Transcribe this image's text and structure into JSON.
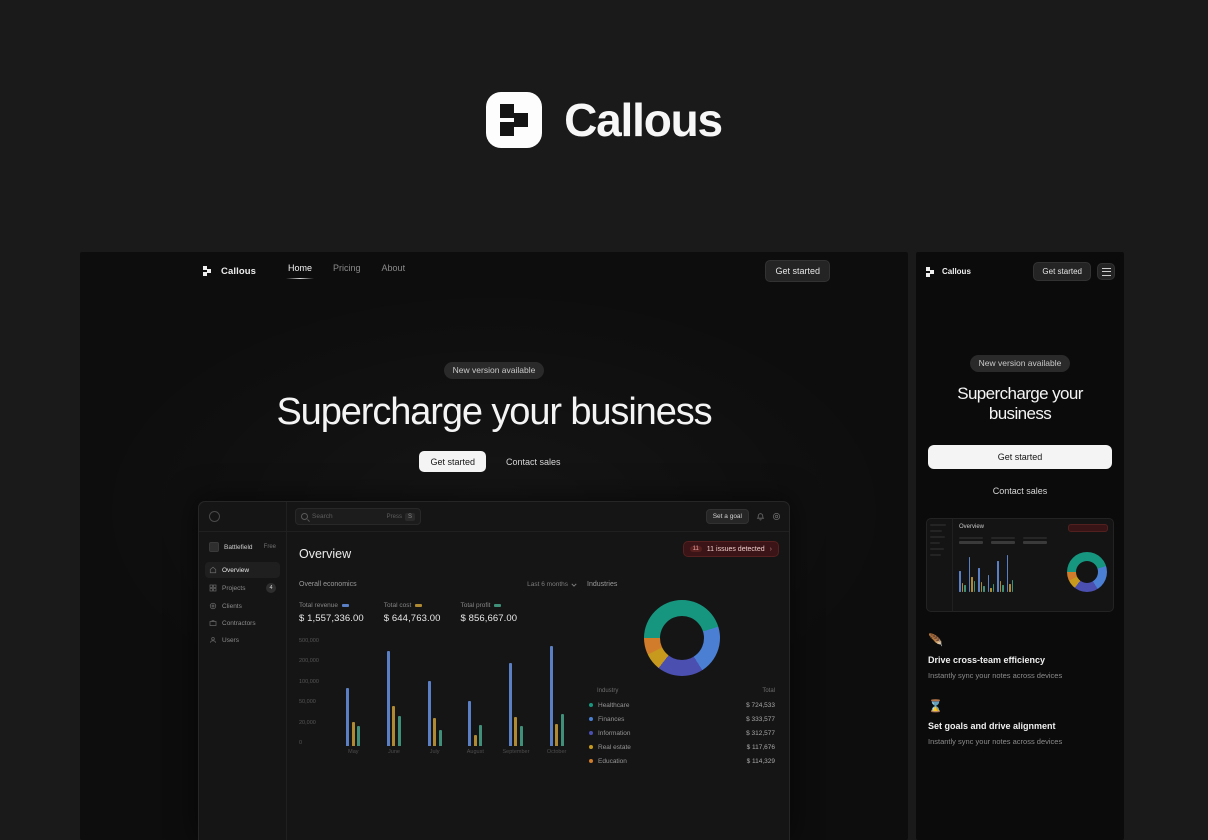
{
  "brand": {
    "name": "Callous",
    "mark_icon": "callous-logo-icon"
  },
  "desktop": {
    "nav": {
      "brand": "Callous",
      "links": [
        {
          "label": "Home",
          "active": true
        },
        {
          "label": "Pricing",
          "active": false
        },
        {
          "label": "About",
          "active": false
        }
      ],
      "cta": "Get started"
    },
    "hero": {
      "badge": "New version available",
      "heading": "Supercharge your business",
      "primary_cta": "Get started",
      "secondary_cta": "Contact sales"
    },
    "dashboard": {
      "search_placeholder": "Search",
      "shortcut_label": "Press",
      "shortcut_key": "S",
      "goal_button": "Set a goal",
      "bell_icon": "bell-icon",
      "settings_icon": "settings-icon",
      "workspace": {
        "name": "Battlefield",
        "plan": "Free"
      },
      "sidebar": [
        {
          "label": "Overview",
          "icon": "home-icon",
          "badge": "",
          "active": true
        },
        {
          "label": "Projects",
          "icon": "grid-icon",
          "badge": "4",
          "active": false
        },
        {
          "label": "Clients",
          "icon": "target-icon",
          "badge": "",
          "active": false
        },
        {
          "label": "Contractors",
          "icon": "briefcase-icon",
          "badge": "",
          "active": false
        },
        {
          "label": "Users",
          "icon": "user-icon",
          "badge": "",
          "active": false
        }
      ],
      "alert": {
        "count": "11",
        "text": "11 issues detected",
        "chevron": "›"
      },
      "page_title": "Overview",
      "economics": {
        "title": "Overall economics",
        "range": "Last 6 months",
        "chevron_icon": "chevron-down-icon",
        "metrics": [
          {
            "label": "Total revenue",
            "value": "$ 1,557,336.00",
            "color": "#5b7fc4"
          },
          {
            "label": "Total cost",
            "value": "$ 644,763.00",
            "color": "#b08a33"
          },
          {
            "label": "Total profit",
            "value": "$ 856,667.00",
            "color": "#3f8f79"
          }
        ]
      },
      "industries": {
        "title": "Industries",
        "columns": [
          "Industry",
          "Total"
        ],
        "rows": [
          {
            "name": "Healthcare",
            "total": "$ 724,533",
            "color": "#17967f"
          },
          {
            "name": "Finances",
            "total": "$ 333,577",
            "color": "#4a7fd4"
          },
          {
            "name": "Information",
            "total": "$ 312,577",
            "color": "#4b4fb0"
          },
          {
            "name": "Real estate",
            "total": "$ 117,676",
            "color": "#c79a1e"
          },
          {
            "name": "Education",
            "total": "$ 114,329",
            "color": "#d07c2a"
          }
        ]
      }
    }
  },
  "mobile": {
    "nav": {
      "brand": "Callous",
      "cta": "Get started",
      "menu_icon": "hamburger-menu-icon"
    },
    "hero": {
      "badge": "New version available",
      "heading": "Supercharge your business",
      "primary_cta": "Get started",
      "secondary_cta": "Contact sales"
    },
    "features": [
      {
        "icon": "feather-icon",
        "glyph": "🪶",
        "title": "Drive cross-team efficiency",
        "desc": "Instantly sync your notes across devices"
      },
      {
        "icon": "hourglass-icon",
        "glyph": "⌛",
        "title": "Set goals and drive alignment",
        "desc": "Instantly sync your notes across devices"
      }
    ]
  },
  "chart_data": [
    {
      "type": "bar",
      "title": "Overall economics",
      "categories": [
        "May",
        "June",
        "July",
        "August",
        "September",
        "October"
      ],
      "series": [
        {
          "name": "Total revenue",
          "color": "#5b7fc4",
          "values": [
            230000,
            380000,
            260000,
            180000,
            330000,
            400000
          ]
        },
        {
          "name": "Total cost",
          "color": "#b08a33",
          "values": [
            95000,
            160000,
            110000,
            42000,
            115000,
            88000
          ]
        },
        {
          "name": "Total profit",
          "color": "#3f8f79",
          "values": [
            78000,
            118000,
            62000,
            85000,
            80000,
            128000
          ]
        }
      ],
      "ylabel": "",
      "xlabel": "",
      "yticks": [
        "500,000",
        "200,000",
        "100,000",
        "50,000",
        "20,000",
        "0"
      ],
      "grid": false,
      "legend": "top"
    },
    {
      "type": "pie",
      "title": "Industries",
      "labels": [
        "Healthcare",
        "Finances",
        "Information",
        "Real estate",
        "Education"
      ],
      "values": [
        724533,
        333577,
        312577,
        117676,
        114329
      ],
      "colors": [
        "#17967f",
        "#4a7fd4",
        "#4b4fb0",
        "#c79a1e",
        "#d07c2a"
      ],
      "legend": "table"
    }
  ]
}
